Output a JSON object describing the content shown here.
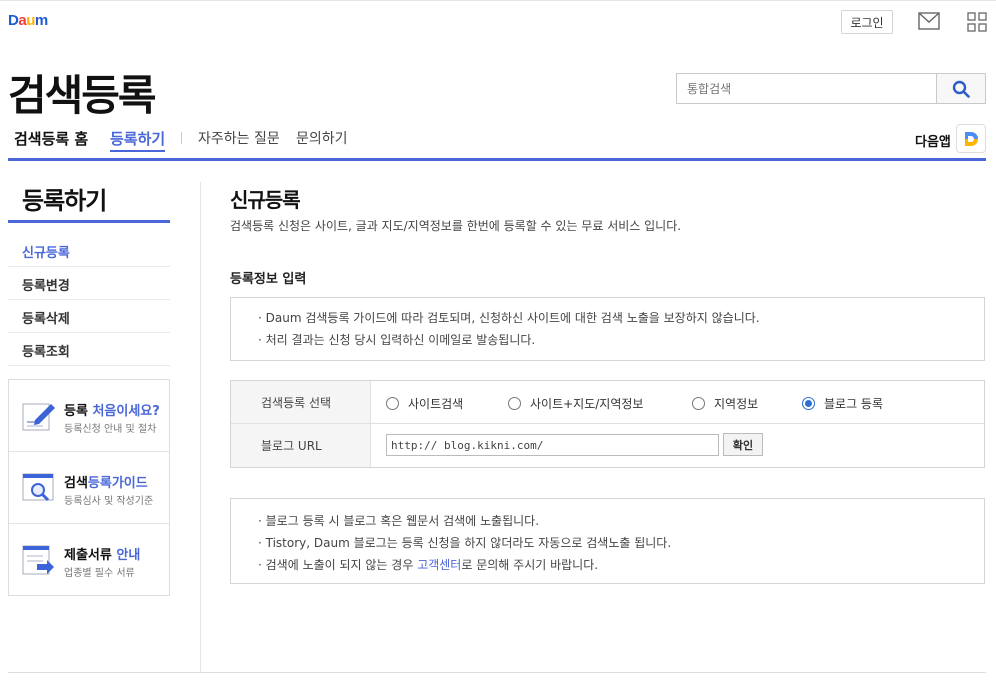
{
  "topbar": {
    "logo": "Daum",
    "login_label": "로그인",
    "icons": {
      "mail": "mail-icon",
      "apps": "apps-grid-icon"
    }
  },
  "header": {
    "service_title": "검색등록",
    "search_placeholder": "통합검색"
  },
  "gnb": {
    "home": "검색등록 홈",
    "register": "등록하기",
    "faq": "자주하는 질문",
    "qna": "문의하기",
    "daum_app": "다음앱"
  },
  "lnb": {
    "title": "등록하기",
    "items": [
      {
        "label": "신규등록",
        "active": true
      },
      {
        "label": "등록변경",
        "active": false
      },
      {
        "label": "등록삭제",
        "active": false
      },
      {
        "label": "등록조회",
        "active": false
      }
    ],
    "banners": [
      {
        "title_plain": "등록 ",
        "title_highlight": "처음이세요?",
        "sub": "등록신청 안내 및 절차",
        "icon": "pencil-icon"
      },
      {
        "title_plain": "검색",
        "title_highlight": "등록가이드",
        "sub": "등록심사 및 작성기준",
        "icon": "magnifier-icon"
      },
      {
        "title_plain": "제출서류 ",
        "title_highlight": "안내",
        "sub": "업종별 필수 서류",
        "icon": "documents-icon"
      }
    ]
  },
  "content": {
    "title": "신규등록",
    "desc": "검색등록 신청은 사이트, 글과 지도/지역정보를 한번에 등록할 수 있는 무료 서비스 입니다.",
    "section_title": "등록정보 입력",
    "notice1": [
      "· Daum 검색등록 가이드에 따라 검토되며, 신청하신 사이트에 대한 검색 노출을 보장하지 않습니다.",
      "· 처리 결과는 신청 당시 입력하신 이메일로 발송됩니다."
    ],
    "form": {
      "select_label": "검색등록 선택",
      "options": [
        {
          "label": "사이트검색",
          "checked": false
        },
        {
          "label": "사이트+지도/지역정보",
          "checked": false
        },
        {
          "label": "지역정보",
          "checked": false
        },
        {
          "label": "블로그 등록",
          "checked": true
        }
      ],
      "url_label": "블로그 URL",
      "url_value": "http:// blog.kikni.com/",
      "confirm_label": "확인"
    },
    "notice2": {
      "line1": "· 블로그 등록 시 블로그 혹은 웹문서 검색에 노출됩니다.",
      "line2": "· Tistory, Daum 블로그는 등록 신청을 하지 않더라도 자동으로 검색노출 됩니다.",
      "line3_pre": "· 검색에 노출이 되지 않는 경우 ",
      "line3_link": "고객센터",
      "line3_post": "로 문의해 주시기 바랍니다."
    }
  },
  "colors": {
    "accent": "#4a67d8",
    "radio_on": "#2f6fd0"
  }
}
